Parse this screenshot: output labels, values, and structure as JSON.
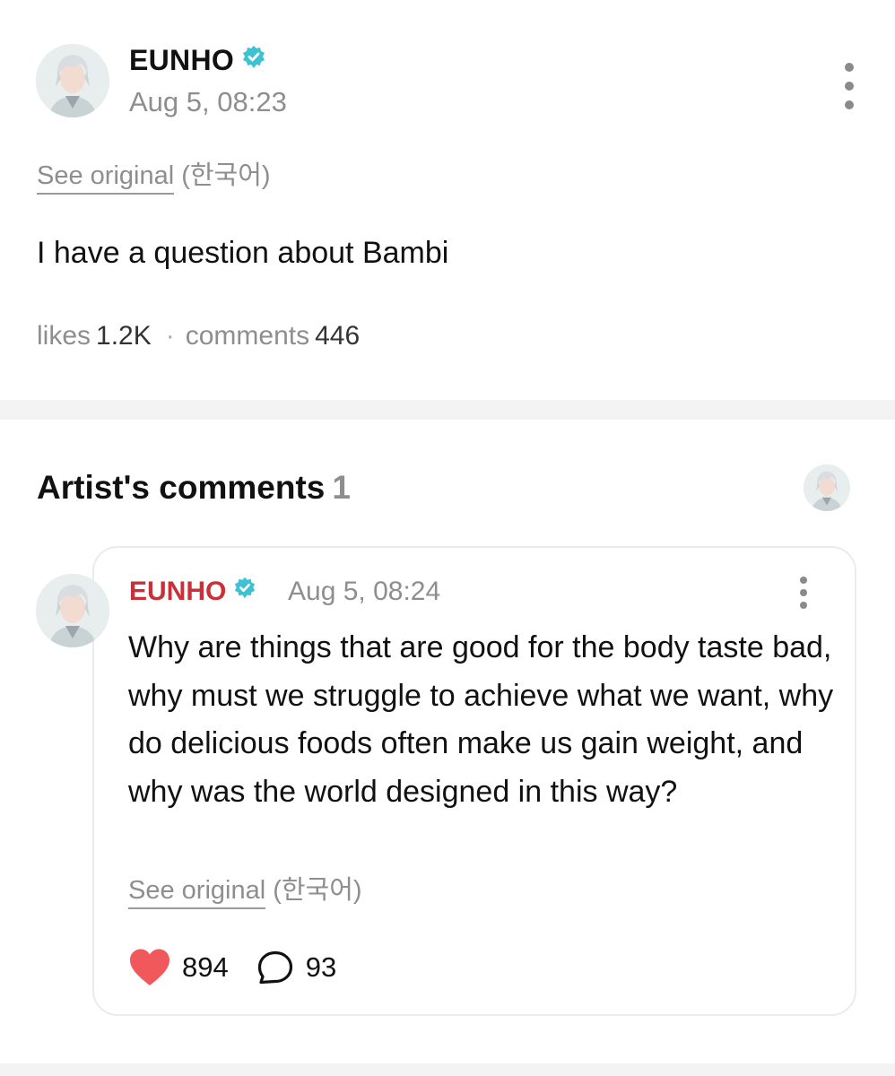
{
  "post": {
    "author": "EUNHO",
    "timestamp": "Aug 5, 08:23",
    "see_original": "See original",
    "original_language": "(한국어)",
    "body": "I have a question about Bambi",
    "likes_label": "likes",
    "likes_count": "1.2K",
    "separator": "·",
    "comments_label": "comments",
    "comments_count": "446"
  },
  "artist_comments": {
    "title": "Artist's comments",
    "count": "1"
  },
  "comment": {
    "author": "EUNHO",
    "timestamp": "Aug 5, 08:24",
    "body": "Why are things that are good for the body taste bad, why must we struggle to achieve what we want, why do delicious foods often make us gain weight, and why was the world designed in this way?",
    "see_original": "See original",
    "original_language": "(한국어)",
    "like_count": "894",
    "reply_count": "93"
  },
  "icons": {
    "verified": "verified-badge-icon",
    "more": "more-vertical-icon",
    "like": "heart-icon",
    "reply": "speech-bubble-icon"
  },
  "colors": {
    "verified": "#3ec1d3",
    "comment_author": "#c8303a",
    "heart": "#f0585c",
    "muted_text": "#8e8e8e"
  }
}
